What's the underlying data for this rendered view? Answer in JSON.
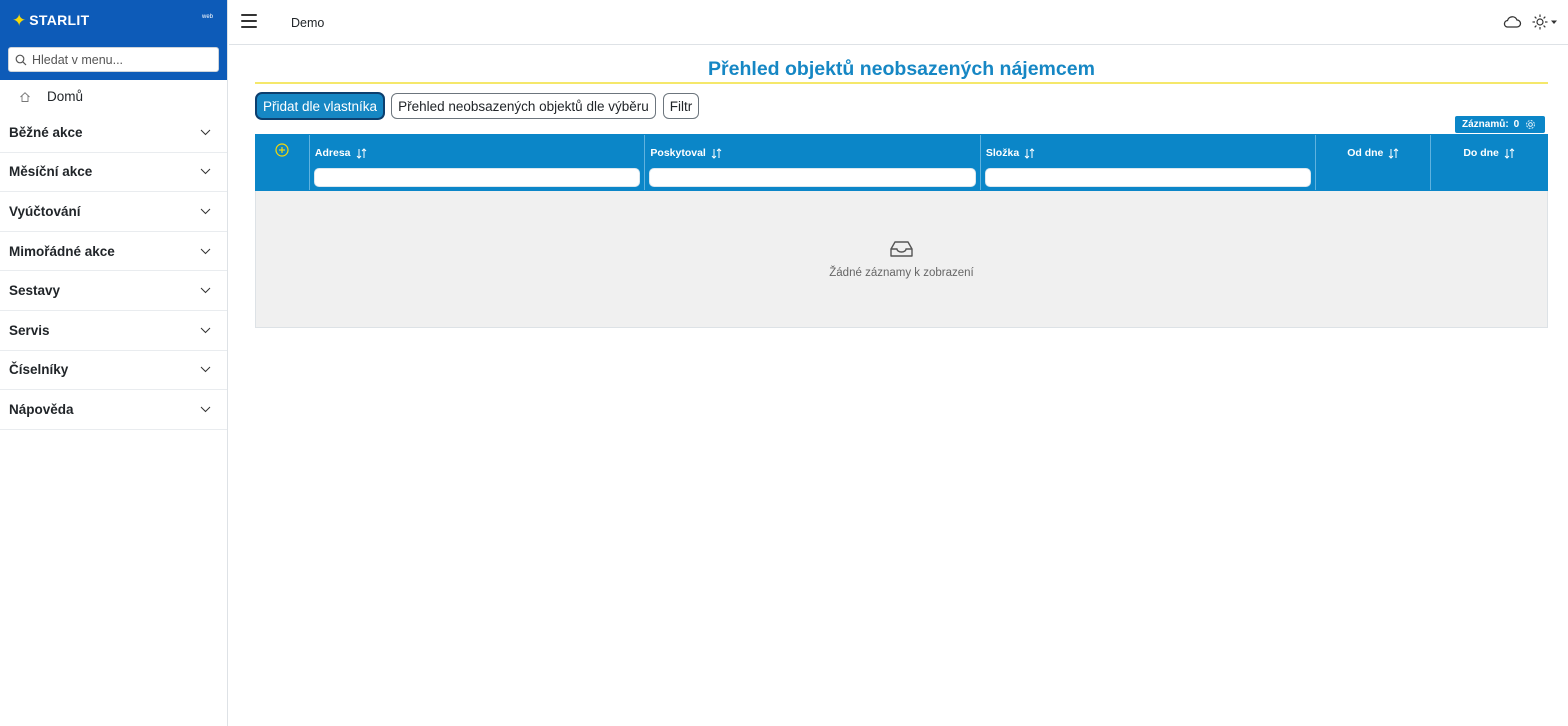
{
  "brand": {
    "name": "STARLIT",
    "sub": "web"
  },
  "sidebar": {
    "search_placeholder": "Hledat v menu...",
    "home_label": "Domů",
    "items": [
      {
        "label": "Běžné akce"
      },
      {
        "label": "Měsíční akce"
      },
      {
        "label": "Vyúčtování"
      },
      {
        "label": "Mimořádné akce"
      },
      {
        "label": "Sestavy"
      },
      {
        "label": "Servis"
      },
      {
        "label": "Číselníky"
      },
      {
        "label": "Nápověda"
      }
    ]
  },
  "topbar": {
    "title": "Demo",
    "icons": [
      "menu-icon",
      "cloud-icon",
      "sun-icon"
    ]
  },
  "main": {
    "title": "Přehled objektů neobsazených nájemcem",
    "buttons": {
      "add_by_owner": "Přidat dle vlastníka",
      "overview_selection": "Přehled neobsazených objektů dle výběru",
      "filter": "Filtr"
    },
    "records": {
      "label": "Záznamů:",
      "count": "0"
    },
    "table": {
      "columns": [
        "Adresa",
        "Poskytoval",
        "Složka",
        "Od dne",
        "Do dne"
      ],
      "empty_text": "Žádné záznamy k zobrazení"
    }
  },
  "colors": {
    "brand_blue": "#0d5bb8",
    "accent": "#1687c4",
    "table_header": "#0b86c8",
    "title_rule": "#f5e86b",
    "brand_star": "#f5d90a",
    "add_icon": "#f5d90a"
  }
}
